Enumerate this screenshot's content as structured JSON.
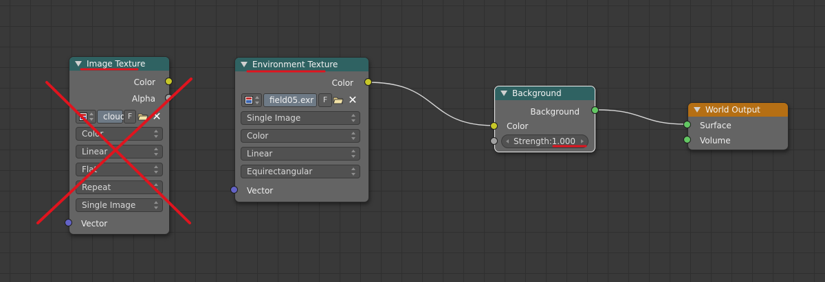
{
  "colors": {
    "header_teal": "#2f6262",
    "header_orange": "#b56f14",
    "node_body": "#646464",
    "socket_color": "#c7c729",
    "socket_shader": "#63c763",
    "socket_vector": "#6363c7",
    "socket_value": "#a1a1a1",
    "annotation_red": "#e0141e",
    "background": "#393939"
  },
  "image_texture": {
    "title": "Image Texture",
    "outputs": [
      "Color",
      "Alpha"
    ],
    "file_name": "cloud",
    "fake_user_label": "F",
    "dropdowns": [
      "Color",
      "Linear",
      "Flat",
      "Repeat",
      "Single Image"
    ],
    "input_label": "Vector",
    "crossed_out": true
  },
  "environment_texture": {
    "title": "Environment Texture",
    "output_label": "Color",
    "file_name": "field05.exr",
    "fake_user_label": "F",
    "dropdowns": [
      "Single Image",
      "Color",
      "Linear",
      "Equirectangular"
    ],
    "input_label": "Vector"
  },
  "background_node": {
    "title": "Background",
    "output_label": "Background",
    "color_input_label": "Color",
    "strength_label": "Strength:",
    "strength_value": "1.000"
  },
  "world_output": {
    "title": "World Output",
    "inputs": [
      "Surface",
      "Volume"
    ]
  },
  "icons": [
    "collapse-triangle-icon",
    "image-icon",
    "folder-icon",
    "close-icon"
  ]
}
